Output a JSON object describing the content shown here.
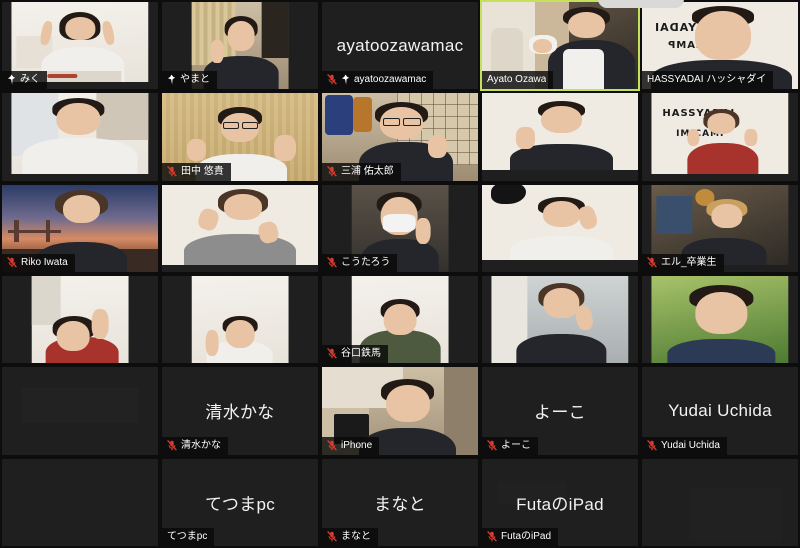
{
  "app": {
    "name": "zoom-gallery-view",
    "background_color": "#0d0d0d",
    "tile_background_color": "#1f1f1f",
    "active_speaker_border_color": "#c5e05a",
    "muted_icon_color": "#d93a2b",
    "pin_icon_color": "#ffffff",
    "grid": {
      "columns": 5,
      "rows": 6
    }
  },
  "icons": {
    "muted": "muted-microphone-icon",
    "pinned": "pinned-icon"
  },
  "participants": [
    {
      "id": "p1",
      "name": "みく",
      "badge": "みく",
      "muted": false,
      "pinned": true,
      "camera_on": true,
      "active_speaker": false,
      "center_name": ""
    },
    {
      "id": "p2",
      "name": "やまと",
      "badge": "やまと",
      "muted": false,
      "pinned": true,
      "camera_on": true,
      "active_speaker": false,
      "center_name": ""
    },
    {
      "id": "p3",
      "name": "ayatoozawamac",
      "badge": "ayatoozawamac",
      "muted": true,
      "pinned": true,
      "camera_on": false,
      "active_speaker": false,
      "center_name": "ayatoozawamac"
    },
    {
      "id": "p4",
      "name": "Ayato Ozawa",
      "badge": "Ayato Ozawa",
      "muted": false,
      "pinned": false,
      "camera_on": true,
      "active_speaker": true,
      "center_name": ""
    },
    {
      "id": "p5",
      "name": "HASSYADAI ハッシャダイ",
      "badge": "HASSYADAI ハッシャダイ",
      "muted": false,
      "pinned": false,
      "camera_on": true,
      "active_speaker": false,
      "center_name": ""
    },
    {
      "id": "p6",
      "name": "",
      "badge": "",
      "muted": false,
      "pinned": false,
      "camera_on": true,
      "active_speaker": false,
      "center_name": ""
    },
    {
      "id": "p7",
      "name": "田中 悠貴",
      "badge": "田中 悠貴",
      "muted": true,
      "pinned": false,
      "camera_on": true,
      "active_speaker": false,
      "center_name": ""
    },
    {
      "id": "p8",
      "name": "三浦 佑太郎",
      "badge": "三浦 佑太郎",
      "muted": true,
      "pinned": false,
      "camera_on": true,
      "active_speaker": false,
      "center_name": ""
    },
    {
      "id": "p9",
      "name": "",
      "badge": "",
      "muted": false,
      "pinned": false,
      "camera_on": true,
      "active_speaker": false,
      "center_name": ""
    },
    {
      "id": "p10",
      "name": "",
      "badge": "",
      "muted": false,
      "pinned": false,
      "camera_on": true,
      "active_speaker": false,
      "center_name": ""
    },
    {
      "id": "p11",
      "name": "Riko Iwata",
      "badge": "Riko Iwata",
      "muted": true,
      "pinned": false,
      "camera_on": true,
      "active_speaker": false,
      "center_name": ""
    },
    {
      "id": "p12",
      "name": "",
      "badge": "",
      "muted": false,
      "pinned": false,
      "camera_on": true,
      "active_speaker": false,
      "center_name": ""
    },
    {
      "id": "p13",
      "name": "こうたろう",
      "badge": "こうたろう",
      "muted": true,
      "pinned": false,
      "camera_on": true,
      "active_speaker": false,
      "center_name": ""
    },
    {
      "id": "p14",
      "name": "",
      "badge": "",
      "muted": false,
      "pinned": false,
      "camera_on": true,
      "active_speaker": false,
      "center_name": ""
    },
    {
      "id": "p15",
      "name": "エル_卒業生",
      "badge": "エル_卒業生",
      "muted": true,
      "pinned": false,
      "camera_on": true,
      "active_speaker": false,
      "center_name": ""
    },
    {
      "id": "p16",
      "name": "",
      "badge": "",
      "muted": false,
      "pinned": false,
      "camera_on": true,
      "active_speaker": false,
      "center_name": ""
    },
    {
      "id": "p17",
      "name": "",
      "badge": "",
      "muted": false,
      "pinned": false,
      "camera_on": true,
      "active_speaker": false,
      "center_name": ""
    },
    {
      "id": "p18",
      "name": "谷口鉄馬",
      "badge": "谷口鉄馬",
      "muted": true,
      "pinned": false,
      "camera_on": true,
      "active_speaker": false,
      "center_name": ""
    },
    {
      "id": "p19",
      "name": "",
      "badge": "",
      "muted": false,
      "pinned": false,
      "camera_on": true,
      "active_speaker": false,
      "center_name": ""
    },
    {
      "id": "p20",
      "name": "",
      "badge": "",
      "muted": false,
      "pinned": false,
      "camera_on": true,
      "active_speaker": false,
      "center_name": ""
    },
    {
      "id": "p21",
      "name": "",
      "badge": "",
      "muted": false,
      "pinned": false,
      "camera_on": false,
      "active_speaker": false,
      "center_name": ""
    },
    {
      "id": "p22",
      "name": "清水かな",
      "badge": "清水かな",
      "muted": true,
      "pinned": false,
      "camera_on": false,
      "active_speaker": false,
      "center_name": "清水かな"
    },
    {
      "id": "p23",
      "name": "iPhone",
      "badge": "iPhone",
      "muted": true,
      "pinned": false,
      "camera_on": true,
      "active_speaker": false,
      "center_name": ""
    },
    {
      "id": "p24",
      "name": "よーこ",
      "badge": "よーこ",
      "muted": true,
      "pinned": false,
      "camera_on": false,
      "active_speaker": false,
      "center_name": "よーこ"
    },
    {
      "id": "p25",
      "name": "Yudai Uchida",
      "badge": "Yudai Uchida",
      "muted": true,
      "pinned": false,
      "camera_on": false,
      "active_speaker": false,
      "center_name": "Yudai Uchida"
    },
    {
      "id": "p26",
      "name": "",
      "badge": "",
      "muted": false,
      "pinned": false,
      "camera_on": false,
      "active_speaker": false,
      "center_name": ""
    },
    {
      "id": "p27",
      "name": "てつまpc",
      "badge": "てつまpc",
      "muted": false,
      "pinned": false,
      "camera_on": false,
      "active_speaker": false,
      "center_name": "てつまpc"
    },
    {
      "id": "p28",
      "name": "まなと",
      "badge": "まなと",
      "muted": true,
      "pinned": false,
      "camera_on": false,
      "active_speaker": false,
      "center_name": "まなと"
    },
    {
      "id": "p29",
      "name": "FutaのiPad",
      "badge": "FutaのiPad",
      "muted": true,
      "pinned": false,
      "camera_on": false,
      "active_speaker": false,
      "center_name": "FutaのiPad"
    },
    {
      "id": "p30",
      "name": "",
      "badge": "",
      "muted": false,
      "pinned": false,
      "camera_on": false,
      "active_speaker": false,
      "center_name": ""
    }
  ]
}
